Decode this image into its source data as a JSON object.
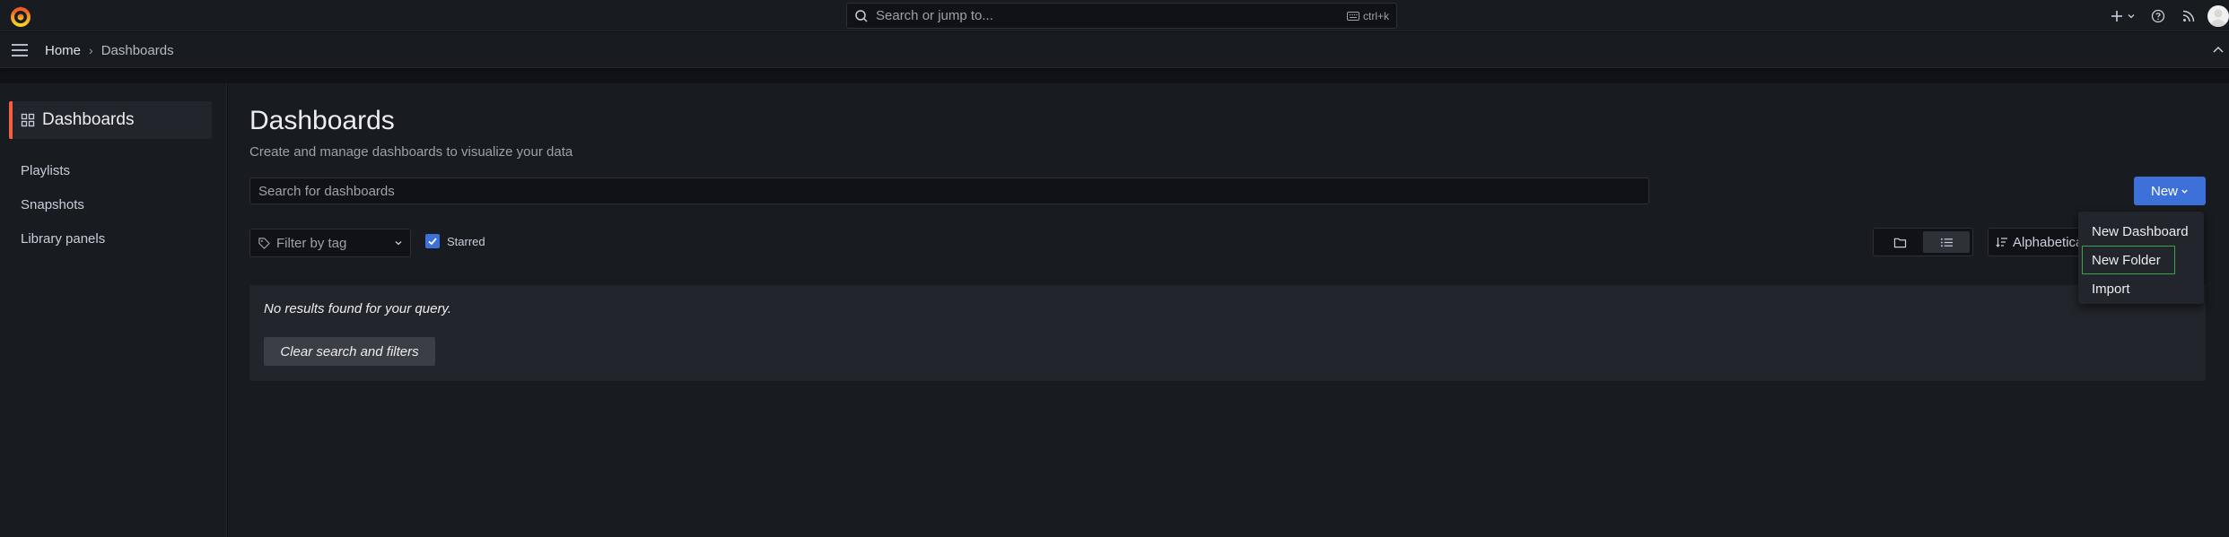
{
  "topbar": {
    "search_placeholder": "Search or jump to...",
    "search_shortcut": "ctrl+k"
  },
  "breadcrumb": {
    "home": "Home",
    "current": "Dashboards"
  },
  "sidebar": {
    "active_label": "Dashboards",
    "items": [
      {
        "label": "Playlists"
      },
      {
        "label": "Snapshots"
      },
      {
        "label": "Library panels"
      }
    ]
  },
  "main": {
    "title": "Dashboards",
    "subtitle": "Create and manage dashboards to visualize your data",
    "search_placeholder": "Search for dashboards",
    "new_button": "New",
    "filter_tag_placeholder": "Filter by tag",
    "starred_label": "Starred",
    "starred_checked": true,
    "sort_label": "Alphabetically (A-Z)",
    "empty_message": "No results found for your query.",
    "clear_button": "Clear search and filters"
  },
  "new_menu": {
    "items": [
      {
        "label": "New Dashboard"
      },
      {
        "label": "New Folder"
      },
      {
        "label": "Import"
      }
    ]
  },
  "colors": {
    "accent_blue": "#3d71d9",
    "active_border": "#f55f3e",
    "focus_green": "#3ca34c",
    "background": "#111217",
    "panel": "#181b1f"
  }
}
